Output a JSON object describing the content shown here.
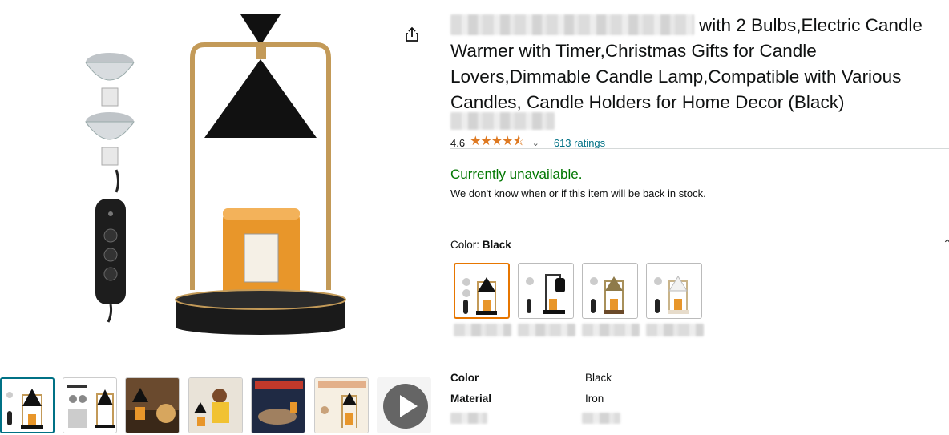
{
  "product": {
    "title": "with 2 Bulbs,Electric Candle Warmer with Timer,Christmas Gifts for Candle Lovers,Dimmable Candle Lamp,Compatible with Various Candles, Candle Holders for Home Decor (Black)",
    "rating_value": "4.6",
    "stars": "★★★★⯪",
    "ratings_count": "613 ratings",
    "availability": "Currently unavailable.",
    "availability_detail": "We don't know when or if this item will be back in stock.",
    "color_label": "Color:",
    "color_value": "Black",
    "variants": [
      "black",
      "black-dome",
      "brass",
      "white"
    ],
    "specs": [
      {
        "key": "Color",
        "value": "Black"
      },
      {
        "key": "Material",
        "value": "Iron"
      }
    ]
  },
  "icons": {
    "share": "share-icon",
    "chevron": "chevron-down-icon",
    "collapse": "chevron-up-icon",
    "play": "play-icon"
  },
  "colors": {
    "accent_orange": "#e77600",
    "link": "#007185",
    "in_stock_green": "#007600",
    "star": "#de7921"
  }
}
